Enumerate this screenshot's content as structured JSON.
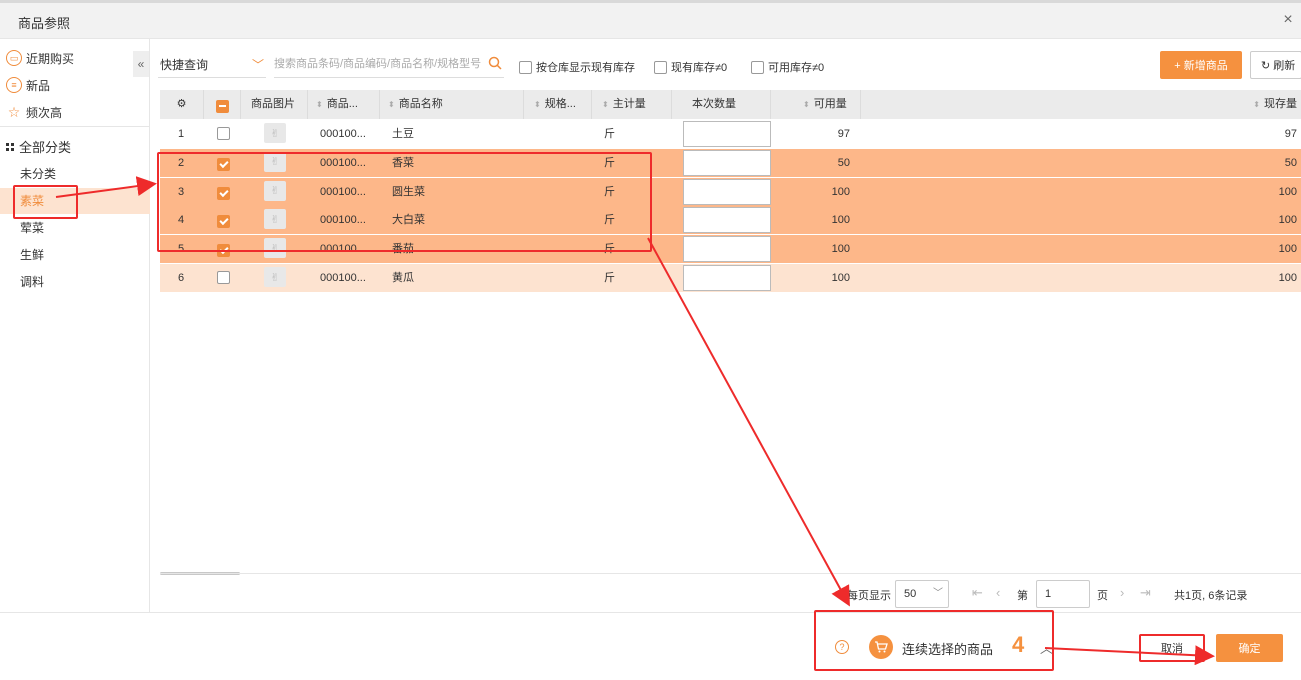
{
  "window": {
    "title": "商品参照",
    "close_glyph": "×"
  },
  "sidebar": {
    "quick_items": [
      {
        "label": "近期购买",
        "icon": "bag-icon"
      },
      {
        "label": "新品",
        "icon": "new-icon"
      },
      {
        "label": "频次高",
        "icon": "star-icon"
      }
    ],
    "collapse_glyph": "«",
    "category_header": "全部分类",
    "categories": [
      {
        "label": "未分类",
        "active": false
      },
      {
        "label": "素菜",
        "active": true
      },
      {
        "label": "荤菜",
        "active": false
      },
      {
        "label": "生鲜",
        "active": false
      },
      {
        "label": "调料",
        "active": false
      }
    ]
  },
  "toolbar": {
    "quick_query": "快捷查询",
    "search_placeholder": "搜索商品条码/商品编码/商品名称/规格型号",
    "checkboxes": [
      {
        "label": "按仓库显示现有库存",
        "checked": false
      },
      {
        "label": "现有库存≠0",
        "checked": false
      },
      {
        "label": "可用库存≠0",
        "checked": false
      }
    ],
    "add_button": "+ 新增商品",
    "refresh_button": "刷新"
  },
  "table": {
    "headers": {
      "settings": "",
      "image": "商品图片",
      "code": "商品...",
      "name": "商品名称",
      "spec": "规格...",
      "unit": "主计量",
      "qty": "本次数量",
      "available": "可用量",
      "stock": "现存量"
    },
    "rows": [
      {
        "idx": "1",
        "checked": false,
        "code": "000100...",
        "name": "土豆",
        "unit": "斤",
        "available": "97",
        "stock": "97",
        "highlight": "none"
      },
      {
        "idx": "2",
        "checked": true,
        "code": "000100...",
        "name": "香菜",
        "unit": "斤",
        "available": "50",
        "stock": "50",
        "highlight": "selected"
      },
      {
        "idx": "3",
        "checked": true,
        "code": "000100...",
        "name": "圆生菜",
        "unit": "斤",
        "available": "100",
        "stock": "100",
        "highlight": "selected"
      },
      {
        "idx": "4",
        "checked": true,
        "code": "000100...",
        "name": "大白菜",
        "unit": "斤",
        "available": "100",
        "stock": "100",
        "highlight": "selected"
      },
      {
        "idx": "5",
        "checked": true,
        "code": "000100...",
        "name": "番茄",
        "unit": "斤",
        "available": "100",
        "stock": "100",
        "highlight": "selected"
      },
      {
        "idx": "6",
        "checked": false,
        "code": "000100...",
        "name": "黄瓜",
        "unit": "斤",
        "available": "100",
        "stock": "100",
        "highlight": "hover"
      }
    ]
  },
  "pager": {
    "per_page_label": "每页显示",
    "page_size": "50",
    "page_prefix": "第",
    "page_value": "1",
    "page_suffix": "页",
    "summary": "共1页, 6条记录"
  },
  "footer": {
    "continuous_label": "连续选择的商品",
    "continuous_count": "4",
    "cancel_button": "取消",
    "ok_button": "确定"
  },
  "colors": {
    "accent": "#f5913f",
    "selected_row": "#fdb789",
    "annotation": "#ee2b2b"
  }
}
